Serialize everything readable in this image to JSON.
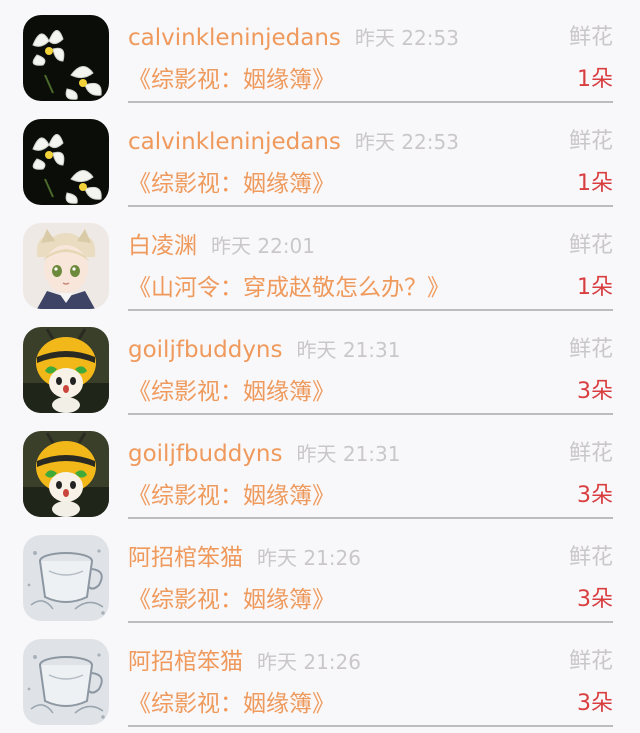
{
  "rows": [
    {
      "avatar": "orchid-avatar",
      "username": "calvinkleninjedans",
      "time": "昨天 22:53",
      "gift": "鲜花",
      "book": "《综影视：姻缘簿》",
      "count": "1朵"
    },
    {
      "avatar": "orchid-avatar",
      "username": "calvinkleninjedans",
      "time": "昨天 22:53",
      "gift": "鲜花",
      "book": "《综影视：姻缘簿》",
      "count": "1朵"
    },
    {
      "avatar": "anime-cat-ears-avatar",
      "username": "白凌渊",
      "time": "昨天 22:01",
      "gift": "鲜花",
      "book": "《山河令：穿成赵敬怎么办？》",
      "count": "1朵"
    },
    {
      "avatar": "bee-doll-avatar",
      "username": "goiljfbuddyns",
      "time": "昨天 21:31",
      "gift": "鲜花",
      "book": "《综影视：姻缘簿》",
      "count": "3朵"
    },
    {
      "avatar": "bee-doll-avatar",
      "username": "goiljfbuddyns",
      "time": "昨天 21:31",
      "gift": "鲜花",
      "book": "《综影视：姻缘簿》",
      "count": "3朵"
    },
    {
      "avatar": "glass-cup-avatar",
      "username": "阿招棺笨猫",
      "time": "昨天 21:26",
      "gift": "鲜花",
      "book": "《综影视：姻缘簿》",
      "count": "3朵"
    },
    {
      "avatar": "glass-cup-avatar",
      "username": "阿招棺笨猫",
      "time": "昨天 21:26",
      "gift": "鲜花",
      "book": "《综影视：姻缘簿》",
      "count": "3朵"
    }
  ],
  "colors": {
    "username": "#ef9a5c",
    "muted": "#c9c7cb",
    "count": "#d83d40",
    "divider": "#bcbcbf",
    "background": "#f8f7f9"
  }
}
